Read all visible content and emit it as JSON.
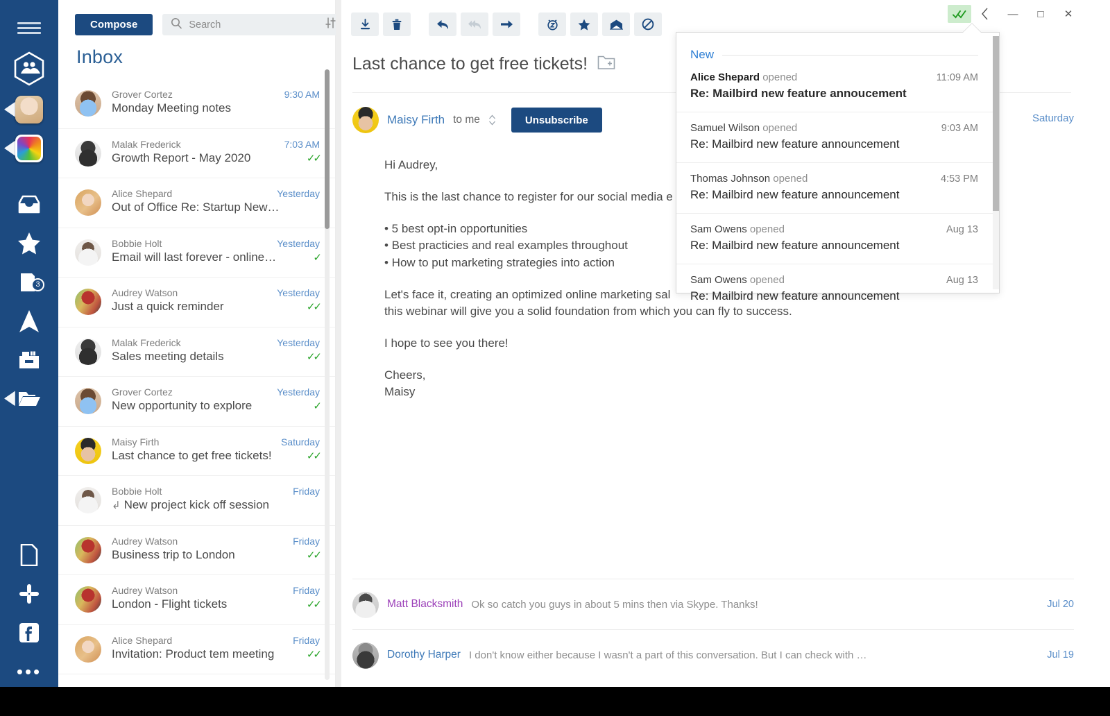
{
  "window": {
    "controls": {
      "tracking_icon": "double-check-icon",
      "back_icon": "chevron-left-icon",
      "minimize_label": "—",
      "maximize_label": "□",
      "close_label": "✕"
    }
  },
  "rail": {
    "items": [
      {
        "name": "menu-hamburger",
        "icon": "hamburger-icon"
      },
      {
        "name": "contacts",
        "icon": "contacts-hexagon-icon"
      },
      {
        "name": "account-audrey",
        "icon": "avatar-icon"
      },
      {
        "name": "account-colorful",
        "icon": "app-tile-icon"
      },
      {
        "name": "inbox",
        "icon": "inbox-tray-icon"
      },
      {
        "name": "starred",
        "icon": "star-icon"
      },
      {
        "name": "drafts",
        "icon": "drafts-icon",
        "badge": "3"
      },
      {
        "name": "sent",
        "icon": "paper-plane-icon"
      },
      {
        "name": "archive",
        "icon": "archive-box-icon"
      },
      {
        "name": "folders",
        "icon": "folder-icon"
      },
      {
        "name": "notes",
        "icon": "document-icon"
      },
      {
        "name": "slack",
        "icon": "slack-icon"
      },
      {
        "name": "facebook",
        "icon": "facebook-icon"
      },
      {
        "name": "more",
        "icon": "ellipsis-icon",
        "glyph": "•••"
      }
    ]
  },
  "list": {
    "compose_label": "Compose",
    "search_placeholder": "Search",
    "search_value": "",
    "search_icon": "search-icon",
    "filter_icon": "filter-sliders-icon",
    "folder_title": "Inbox",
    "messages": [
      {
        "from": "Grover Cortez",
        "subject": "Monday Meeting notes",
        "date": "9:30 AM",
        "ticks": "",
        "face": "f-grover",
        "reply": false
      },
      {
        "from": "Malak Frederick",
        "subject": "Growth Report - May 2020",
        "date": "7:03 AM",
        "ticks": "✓✓",
        "face": "f-malak",
        "reply": false
      },
      {
        "from": "Alice Shepard",
        "subject": "Out of Office Re: Startup New…",
        "date": "Yesterday",
        "ticks": "",
        "face": "f-alice",
        "reply": false
      },
      {
        "from": "Bobbie Holt",
        "subject": "Email will last forever - online…",
        "date": "Yesterday",
        "ticks": "✓",
        "face": "f-bobbie",
        "reply": false
      },
      {
        "from": "Audrey Watson",
        "subject": "Just a quick reminder",
        "date": "Yesterday",
        "ticks": "✓✓",
        "face": "f-audrey",
        "reply": false
      },
      {
        "from": "Malak Frederick",
        "subject": "Sales meeting details",
        "date": "Yesterday",
        "ticks": "✓✓",
        "face": "f-malak",
        "reply": false
      },
      {
        "from": "Grover Cortez",
        "subject": "New opportunity to explore",
        "date": "Yesterday",
        "ticks": "✓",
        "face": "f-grover",
        "reply": false
      },
      {
        "from": "Maisy Firth",
        "subject": "Last chance to get free tickets!",
        "date": "Saturday",
        "ticks": "✓✓",
        "face": "f-maisy",
        "reply": false
      },
      {
        "from": "Bobbie Holt",
        "subject": "New project kick off session",
        "date": "Friday",
        "ticks": "",
        "face": "f-bobbie",
        "reply": true
      },
      {
        "from": "Audrey Watson",
        "subject": "Business trip to London",
        "date": "Friday",
        "ticks": "✓✓",
        "face": "f-audrey",
        "reply": false
      },
      {
        "from": "Audrey Watson",
        "subject": "London - Flight tickets",
        "date": "Friday",
        "ticks": "✓✓",
        "face": "f-audrey",
        "reply": false
      },
      {
        "from": "Alice Shepard",
        "subject": "Invitation: Product tem meeting",
        "date": "Friday",
        "ticks": "✓✓",
        "face": "f-alice",
        "reply": false
      }
    ]
  },
  "toolbar": {
    "buttons": [
      {
        "name": "archive-button",
        "icon": "download-archive-icon",
        "disabled": false
      },
      {
        "name": "delete-button",
        "icon": "trash-icon",
        "disabled": false
      },
      {
        "name": "reply-button",
        "icon": "reply-arrow-icon",
        "disabled": false
      },
      {
        "name": "reply-all-button",
        "icon": "reply-all-icon",
        "disabled": true
      },
      {
        "name": "forward-button",
        "icon": "forward-arrow-icon",
        "disabled": false
      },
      {
        "name": "snooze-button",
        "icon": "alarm-clock-icon",
        "disabled": false
      },
      {
        "name": "star-button",
        "icon": "star-icon",
        "disabled": false
      },
      {
        "name": "mark-unread-button",
        "icon": "envelope-open-icon",
        "disabled": false
      },
      {
        "name": "block-button",
        "icon": "block-circle-icon",
        "disabled": false
      }
    ]
  },
  "reading": {
    "subject": "Last chance to get free tickets!",
    "move_to_folder_icon": "folder-plus-icon",
    "sender": "Maisy Firth",
    "recipients": "to me",
    "expand_icon": "chevron-up-down-icon",
    "unsubscribe_label": "Unsubscribe",
    "thread_date": "Saturday",
    "body": {
      "greeting": "Hi Audrey,",
      "paragraph1": "This is the last chance to register for our social media e",
      "bullets": [
        "• 5 best opt-in opportunities",
        "• Best practicies and real examples throughout",
        "• How to put marketing strategies into action"
      ],
      "paragraph2_line1": "Let's face it, creating an optimized online marketing sal",
      "paragraph2_line2": "this webinar will give you a solid foundation from which you can fly to success.",
      "paragraph3": "I hope to see you there!",
      "signoff": "Cheers,",
      "signature": "Maisy"
    },
    "conversation": [
      {
        "name": "Matt Blacksmith",
        "color": "purple",
        "snippet": "Ok so catch you guys in about 5 mins then via Skype. Thanks!",
        "date": "Jul 20",
        "face": "f-matt"
      },
      {
        "name": "Dorothy Harper",
        "color": "blue",
        "snippet": "I don't know either because I wasn't a part of this conversation. But I can check with …",
        "date": "Jul 19",
        "face": "f-dorothy"
      }
    ]
  },
  "popup": {
    "section_label": "New",
    "notifications": [
      {
        "who": "Alice Shepard",
        "action": "opened",
        "time": "11:09 AM",
        "subject": "Re: Mailbird new feature annoucement",
        "is_new": true
      },
      {
        "who": "Samuel Wilson",
        "action": "opened",
        "time": "9:03 AM",
        "subject": "Re: Mailbird new feature announcement",
        "is_new": false
      },
      {
        "who": "Thomas Johnson",
        "action": "opened",
        "time": "4:53 PM",
        "subject": "Re: Mailbird new feature announcement",
        "is_new": false
      },
      {
        "who": "Sam Owens",
        "action": "opened",
        "time": "Aug 13",
        "subject": "Re: Mailbird new feature announcement",
        "is_new": false
      },
      {
        "who": "Sam Owens",
        "action": "opened",
        "time": "Aug 13",
        "subject": "Re: Mailbird new feature announcement",
        "is_new": false
      }
    ]
  },
  "colors": {
    "brand_blue": "#1c4a80",
    "accent_link": "#5a8ec9",
    "tick_green": "#27a327",
    "purple_name": "#9b3fb8",
    "tracking_bg": "#cdeccd"
  }
}
